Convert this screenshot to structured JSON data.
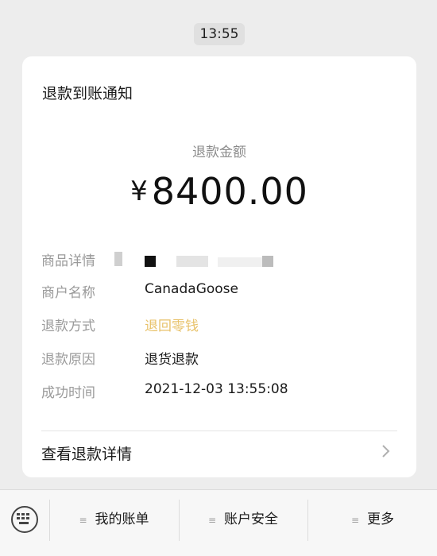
{
  "time": "13:55",
  "card": {
    "title": "退款到账通知",
    "amount_label": "退款金额",
    "currency": "¥",
    "amount": "8400.00",
    "rows": [
      {
        "label": "商品详情",
        "value": ""
      },
      {
        "label": "商户名称",
        "value": "CanadaGoose"
      },
      {
        "label": "退款方式",
        "value": "退回零钱"
      },
      {
        "label": "退款原因",
        "value": "退货退款"
      },
      {
        "label": "成功时间",
        "value": "2021-12-03 13:55:08"
      }
    ],
    "details_link": "查看退款详情"
  },
  "bottom_bar": {
    "menus": [
      "我的账单",
      "账户安全",
      "更多"
    ]
  },
  "icons": {
    "keyboard": "keyboard-icon",
    "chevron": "chevron-right-icon",
    "menu": "hamburger-icon"
  },
  "colors": {
    "accent_gold": "#e8c26a",
    "background": "#ededed"
  }
}
